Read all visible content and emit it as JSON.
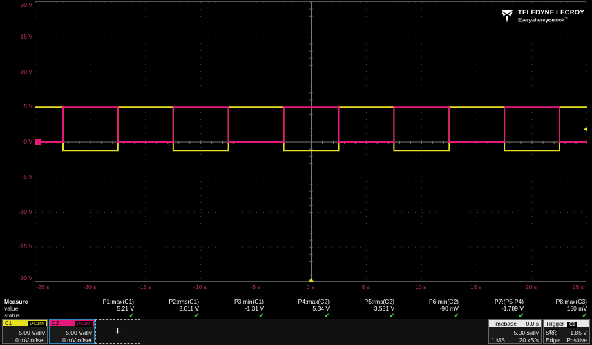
{
  "colors": {
    "c1": "#e6e020",
    "c2": "#e8187a",
    "axis_text": "#c03070",
    "grid": "#444444",
    "check": "#3cd03c",
    "trigger_marker": "#e6e020"
  },
  "brand": {
    "title": "TELEDYNE LECROY",
    "subtitle_pre": "Everywhere",
    "subtitle_bold": "you",
    "subtitle_post": "look",
    "tm": "™",
    "icon": "teledyne-logo-icon"
  },
  "chart_data": {
    "type": "line",
    "xlim": [
      -25,
      25
    ],
    "ylim": [
      -20,
      20
    ],
    "grid": true,
    "y_ticks": [
      "20 V",
      "15 V",
      "10 V",
      "5 V",
      "0 V",
      "-5 V",
      "-10 V",
      "-15 V",
      "-20 V"
    ],
    "y_tick_values": [
      20,
      15,
      10,
      5,
      0,
      -5,
      -10,
      -15,
      -20
    ],
    "x_ticks": [
      "-25 s",
      "-20 s",
      "-15 s",
      "-10 s",
      "-5 s",
      "0 s",
      "5 s",
      "10 s",
      "15 s",
      "20 s",
      "25 s"
    ],
    "x_tick_values": [
      -25,
      -20,
      -15,
      -10,
      -5,
      0,
      5,
      10,
      15,
      20,
      25
    ],
    "series": [
      {
        "name": "C1",
        "color": "#e6e020",
        "high": 5.0,
        "low": -1.2,
        "edges": [
          -22.5,
          -17.5,
          -12.5,
          -7.5,
          -2.5,
          2.5,
          7.5,
          12.5,
          17.5,
          22.5
        ],
        "start_level": "high"
      },
      {
        "name": "C2",
        "color": "#e8187a",
        "high": 5.0,
        "low": 0.0,
        "edges": [
          -22.5,
          -17.5,
          -12.5,
          -7.5,
          -2.5,
          2.5,
          7.5,
          12.5,
          17.5,
          22.5
        ],
        "start_level": "low"
      }
    ],
    "trigger_marker_x": 0,
    "trigger_level_y": 1.85
  },
  "measure": {
    "label": "Measure",
    "value_label": "value",
    "status_label": "status",
    "params": [
      {
        "name": "P1:max(C1)",
        "value": "5.21 V",
        "status": "✔"
      },
      {
        "name": "P2:rms(C1)",
        "value": "3.611 V",
        "status": "✔"
      },
      {
        "name": "P3:min(C1)",
        "value": "-1.31 V",
        "status": "✔"
      },
      {
        "name": "P4:max(C2)",
        "value": "5.34 V",
        "status": "✔"
      },
      {
        "name": "P5:rms(C2)",
        "value": "3.551 V",
        "status": "✔"
      },
      {
        "name": "P6:min(C2)",
        "value": "-90 mV",
        "status": "✔"
      },
      {
        "name": "P7:(P5-P4)",
        "value": "-1.789 V",
        "status": "✔"
      },
      {
        "name": "P8:max(C3)",
        "value": "150 mV",
        "status": "✔"
      }
    ]
  },
  "channels": [
    {
      "name": "C1",
      "coupling": "DC1M",
      "vdiv": "5.00 V/div",
      "offset": "0 mV offset",
      "color": "#e6e020"
    },
    {
      "name": "C2",
      "coupling": "DC1M",
      "vdiv": "5.00 V/div",
      "offset": "0 mV offset",
      "color": "#e8187a"
    }
  ],
  "add_button": "+",
  "timebase": {
    "label": "Timebase",
    "delay": "0.0 s",
    "tdiv": "5.00 s/div",
    "samples": "1 MS",
    "rate": "20 kS/s"
  },
  "trigger": {
    "label": "Trigger",
    "source": "C1",
    "coupling": "DC",
    "mode": "Stop",
    "level": "1.85 V",
    "type": "Edge",
    "slope": "Positive"
  }
}
